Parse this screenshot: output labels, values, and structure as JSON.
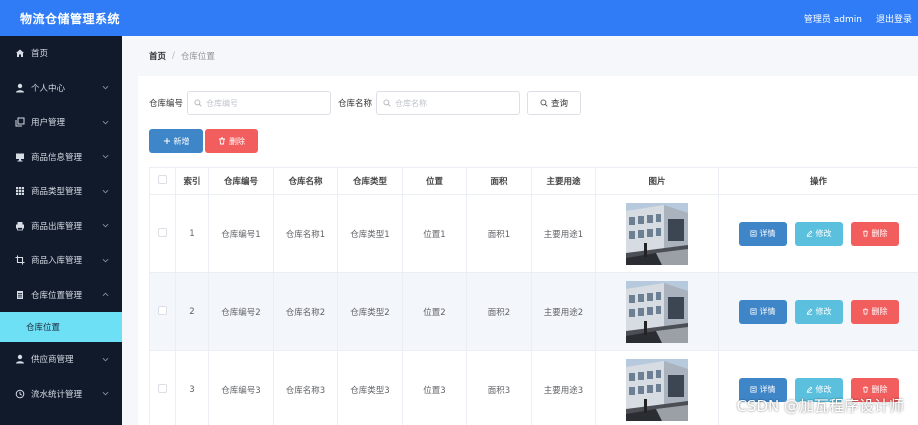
{
  "header": {
    "title": "物流仓储管理系统",
    "user": "管理员 admin",
    "logout": "退出登录"
  },
  "sidebar": {
    "items": [
      {
        "label": "首页",
        "icon": "home-icon",
        "expandable": false
      },
      {
        "label": "个人中心",
        "icon": "user-icon",
        "expandable": true
      },
      {
        "label": "用户管理",
        "icon": "copy-icon",
        "expandable": true
      },
      {
        "label": "商品信息管理",
        "icon": "monitor-icon",
        "expandable": true
      },
      {
        "label": "商品类型管理",
        "icon": "grid-icon",
        "expandable": true
      },
      {
        "label": "商品出库管理",
        "icon": "printer-icon",
        "expandable": true
      },
      {
        "label": "商品入库管理",
        "icon": "crop-icon",
        "expandable": true
      },
      {
        "label": "仓库位置管理",
        "icon": "document-icon",
        "expandable": true,
        "expanded": true
      }
    ],
    "sub_item": "仓库位置",
    "items_after": [
      {
        "label": "供应商管理",
        "icon": "user-icon",
        "expandable": true
      },
      {
        "label": "流水统计管理",
        "icon": "clock-icon",
        "expandable": true
      }
    ]
  },
  "breadcrumb": {
    "home": "首页",
    "separator": "/",
    "current": "仓库位置"
  },
  "search": {
    "field1_label": "仓库编号",
    "field1_placeholder": "仓库编号",
    "field2_label": "仓库名称",
    "field2_placeholder": "仓库名称",
    "query_label": "查询"
  },
  "actions": {
    "add_label": "新增",
    "delete_label": "删除"
  },
  "table": {
    "headers": [
      "索引",
      "仓库编号",
      "仓库名称",
      "仓库类型",
      "位置",
      "面积",
      "主要用途",
      "图片",
      "操作"
    ],
    "rows": [
      {
        "index": "1",
        "code": "仓库编号1",
        "name": "仓库名称1",
        "type": "仓库类型1",
        "location": "位置1",
        "area": "面积1",
        "usage": "主要用途1"
      },
      {
        "index": "2",
        "code": "仓库编号2",
        "name": "仓库名称2",
        "type": "仓库类型2",
        "location": "位置2",
        "area": "面积2",
        "usage": "主要用途2"
      },
      {
        "index": "3",
        "code": "仓库编号3",
        "name": "仓库名称3",
        "type": "仓库类型3",
        "location": "位置3",
        "area": "面积3",
        "usage": "主要用途3"
      }
    ],
    "op_detail": "详情",
    "op_edit": "修改",
    "op_delete": "删除"
  },
  "watermark": "CSDN @加瓦程序设计师",
  "colors": {
    "header_bg": "#2f7cf6",
    "sidebar_bg": "#101a2b",
    "active_sub_bg": "#6ee0f5",
    "primary": "#3f86c8",
    "info": "#5bc0de",
    "danger": "#f25d5d"
  }
}
